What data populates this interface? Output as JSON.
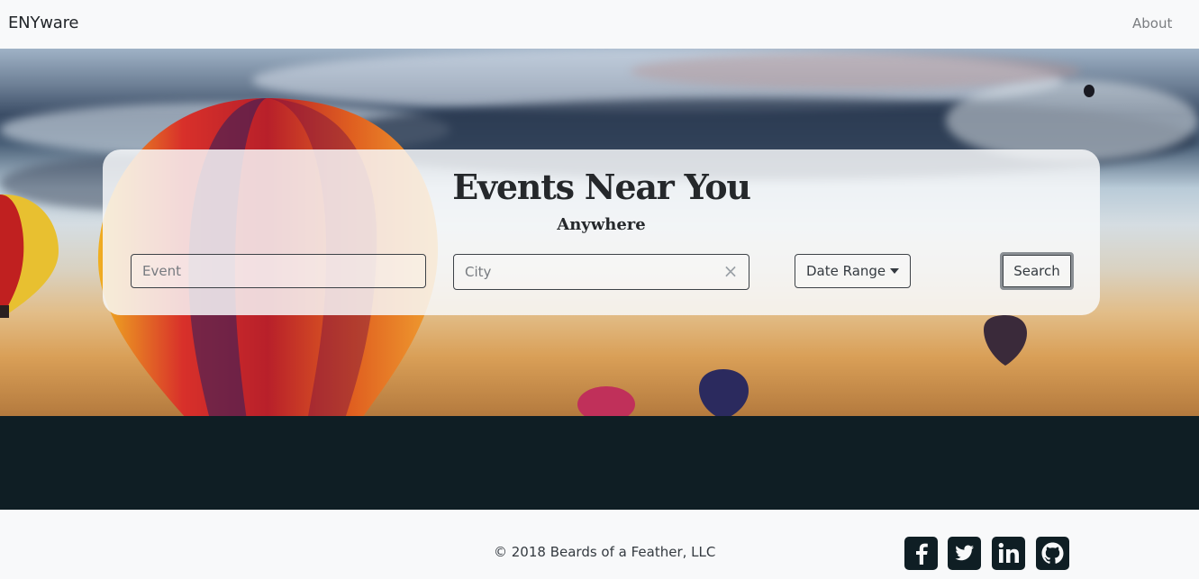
{
  "navbar": {
    "brand": "ENYware",
    "about": "About"
  },
  "hero": {
    "title": "Events Near You",
    "subtitle": "Anywhere"
  },
  "search_form": {
    "event_placeholder": "Event",
    "event_value": "",
    "city_placeholder": "City",
    "city_value": "",
    "clear_glyph": "×",
    "date_range_label": "Date Range",
    "search_label": "Search"
  },
  "footer": {
    "copyright": "© 2018 Beards of a Feather, LLC",
    "social_icons": [
      "facebook-icon",
      "twitter-icon",
      "linkedin-icon",
      "github-icon"
    ]
  },
  "colors": {
    "navbar_bg": "#f8f9fa",
    "dark_band": "#0f1e24",
    "text": "#212529"
  }
}
